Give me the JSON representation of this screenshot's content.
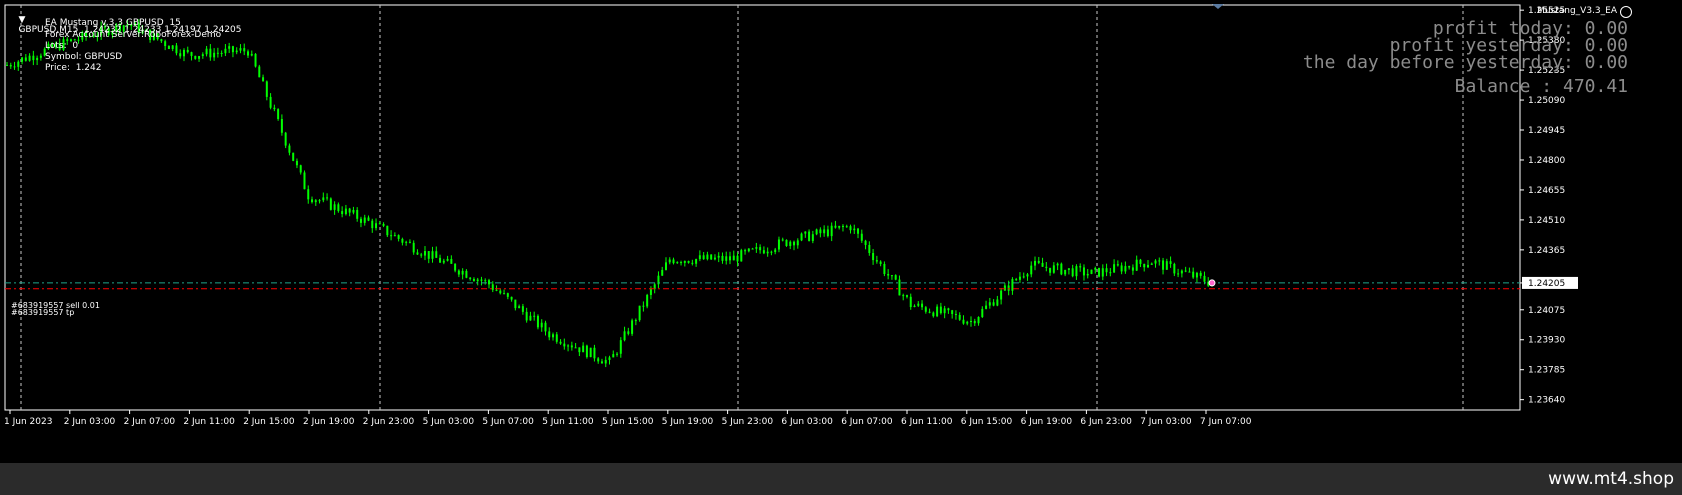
{
  "header": {
    "symbol_line": "GBPUSD,M15  1.24232 1.24233 1.24197 1.24205",
    "ea_name": "Mustang_V3.3_EA"
  },
  "info_panel": {
    "lines": [
      "EA Mustang v.3.3 GBPUSD  15",
      "Forex Account Server:RoboForex-Demo",
      "Lots:  0",
      "Symbol: GBPUSD",
      "Price:  1.242"
    ]
  },
  "stats": {
    "profit_today": "profit today: 0.00",
    "profit_yesterday": "profit yesterday: 0.00",
    "profit_day_before": "the day before yesterday: 0.00",
    "balance": "Balance : 470.41"
  },
  "orders": {
    "sell_label": "#683919557 sell 0.01",
    "tp_label": "#683919557 tp"
  },
  "colors": {
    "background": "#000000",
    "candles": "#00ff00",
    "order_line": "#1fa58c",
    "tp_line": "#ff0000",
    "grid": "#c8c8c8",
    "stats_text": "#8c8c8c"
  },
  "chart_data": {
    "type": "candlestick",
    "symbol": "GBPUSD",
    "timeframe": "M15",
    "x_ticks": [
      "1 Jun 2023",
      "2 Jun 03:00",
      "2 Jun 07:00",
      "2 Jun 11:00",
      "2 Jun 15:00",
      "2 Jun 19:00",
      "2 Jun 23:00",
      "5 Jun 03:00",
      "5 Jun 07:00",
      "5 Jun 11:00",
      "5 Jun 15:00",
      "5 Jun 19:00",
      "5 Jun 23:00",
      "6 Jun 03:00",
      "6 Jun 07:00",
      "6 Jun 11:00",
      "6 Jun 15:00",
      "6 Jun 19:00",
      "6 Jun 23:00",
      "7 Jun 03:00",
      "7 Jun 07:00"
    ],
    "y_ticks": [
      "1.25525",
      "1.25380",
      "1.25235",
      "1.25090",
      "1.24945",
      "1.24800",
      "1.24655",
      "1.24510",
      "1.24365",
      "1.24205",
      "1.24075",
      "1.23930",
      "1.23785",
      "1.23640"
    ],
    "ylim": [
      1.2359,
      1.2555
    ],
    "current_price": "1.24205",
    "order_open_price": 1.24205,
    "tp_price": 1.24177,
    "series": [
      {
        "x": [
          "1 Jun 2023",
          "2 Jun 03:00",
          "2 Jun 07:00",
          "2 Jun 11:00",
          "2 Jun 15:00",
          "2 Jun 19:00",
          "2 Jun 23:00",
          "5 Jun 03:00",
          "5 Jun 07:00",
          "5 Jun 11:00",
          "5 Jun 15:00",
          "5 Jun 19:00",
          "5 Jun 23:00",
          "6 Jun 03:00",
          "6 Jun 07:00",
          "6 Jun 11:00",
          "6 Jun 15:00",
          "6 Jun 19:00",
          "6 Jun 23:00",
          "7 Jun 03:00",
          "7 Jun 07:00"
        ],
        "values": [
          1.2526,
          1.2537,
          1.2546,
          1.2531,
          1.2533,
          1.2463,
          1.245,
          1.2434,
          1.242,
          1.2396,
          1.2382,
          1.2432,
          1.2432,
          1.2441,
          1.2448,
          1.241,
          1.2402,
          1.2429,
          1.2425,
          1.2431,
          1.24205
        ]
      }
    ]
  }
}
